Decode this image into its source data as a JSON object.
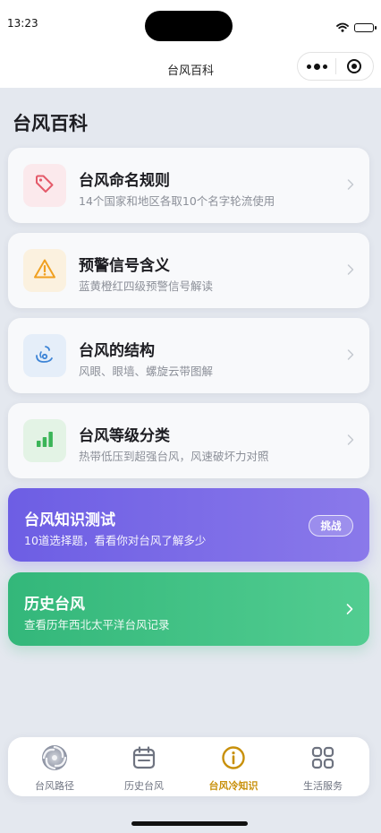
{
  "status_bar": {
    "time": "13:23"
  },
  "nav": {
    "title": "台风百科"
  },
  "page": {
    "title": "台风百科"
  },
  "cards": [
    {
      "title": "台风命名规则",
      "desc": "14个国家和地区各取10个名字轮流使用",
      "icon": "tag-icon",
      "icon_color": "#e45a6a",
      "icon_bg": "#fbe9ec"
    },
    {
      "title": "预警信号含义",
      "desc": "蓝黄橙红四级预警信号解读",
      "icon": "warning-icon",
      "icon_color": "#f0a020",
      "icon_bg": "#fbf1df"
    },
    {
      "title": "台风的结构",
      "desc": "风眼、眼墙、螺旋云带图解",
      "icon": "cyclone-icon",
      "icon_color": "#3d84d6",
      "icon_bg": "#e5eef9"
    },
    {
      "title": "台风等级分类",
      "desc": "热带低压到超强台风，风速破坏力对照",
      "icon": "level-bars-icon",
      "icon_color": "#3bb558",
      "icon_bg": "#e3f3e5"
    }
  ],
  "quiz": {
    "title": "台风知识测试",
    "desc": "10道选择题，看看你对台风了解多少",
    "button": "挑战",
    "color_from": "#6d5ee4",
    "color_to": "#8a79ea"
  },
  "history": {
    "title": "历史台风",
    "desc": "查看历年西北太平洋台风记录",
    "color_from": "#33b77a",
    "color_to": "#52cd91"
  },
  "tabs": [
    {
      "label": "台风路径",
      "icon": "typhoon-swirl-icon",
      "active": false
    },
    {
      "label": "历史台风",
      "icon": "calendar-icon",
      "active": false
    },
    {
      "label": "台风冷知识",
      "icon": "info-icon",
      "active": true
    },
    {
      "label": "生活服务",
      "icon": "grid-icon",
      "active": false
    }
  ],
  "colors": {
    "accent": "#c8900a",
    "background": "#e4e8ef"
  }
}
